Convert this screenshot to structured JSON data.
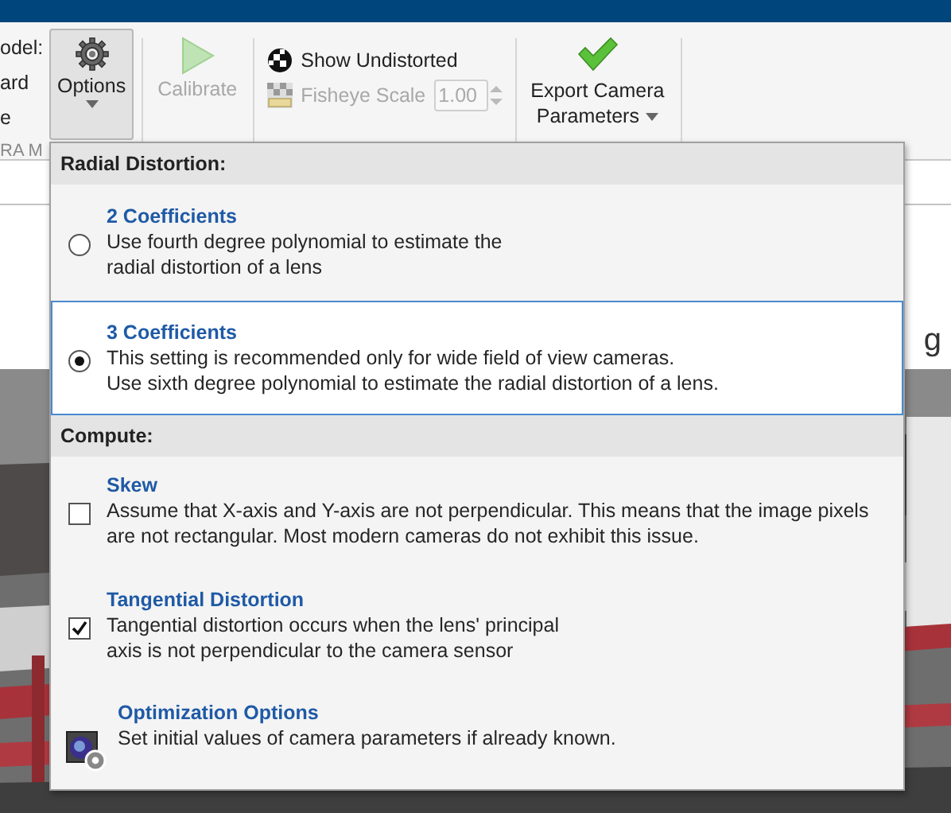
{
  "toolbar": {
    "left_labels": [
      "odel:",
      "ard",
      "e"
    ],
    "section_label": "RA M",
    "options_button": {
      "label": "Options",
      "pressed": true
    },
    "calibrate_button": {
      "label": "Calibrate",
      "disabled": true
    },
    "show_undistorted": {
      "label": "Show Undistorted"
    },
    "fisheye_scale": {
      "label": "Fisheye Scale",
      "value": "1.00",
      "disabled": true
    },
    "export_button": {
      "label_lines": [
        "Export Camera",
        "Parameters"
      ]
    }
  },
  "background_text": "g",
  "options_menu": {
    "sections": [
      {
        "title": "Radial Distortion:",
        "items": [
          {
            "kind": "radio",
            "title": "2 Coefficients",
            "description": [
              "Use fourth degree polynomial to estimate the",
              "radial distortion of a lens"
            ],
            "selected": false
          },
          {
            "kind": "radio",
            "title": "3 Coefficients",
            "description": [
              "This setting is recommended only for wide field of view cameras.",
              "Use sixth degree polynomial to estimate the radial distortion of a lens."
            ],
            "selected": true
          }
        ]
      },
      {
        "title": "Compute:",
        "items": [
          {
            "kind": "checkbox",
            "title": "Skew",
            "description": [
              "Assume that X-axis and Y-axis are not perpendicular. This means that the image pixels",
              "are not rectangular. Most modern cameras do not exhibit this issue."
            ],
            "checked": false
          },
          {
            "kind": "checkbox",
            "title": "Tangential Distortion",
            "description": [
              "Tangential distortion occurs when the lens' principal",
              "axis is not perpendicular to the camera sensor"
            ],
            "checked": true
          },
          {
            "kind": "link",
            "title": "Optimization Options",
            "description": [
              "Set initial values of camera parameters if already known."
            ]
          }
        ]
      }
    ]
  }
}
